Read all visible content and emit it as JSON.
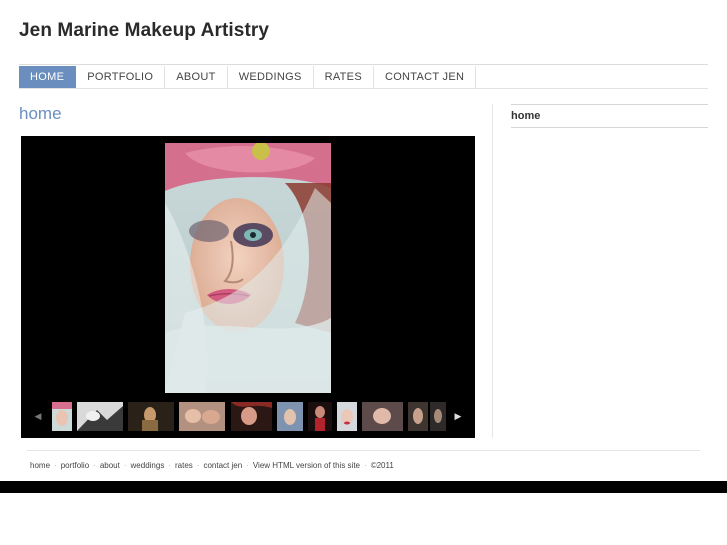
{
  "site": {
    "title": "Jen Marine Makeup Artistry"
  },
  "nav": {
    "items": [
      {
        "label": "HOME",
        "active": true
      },
      {
        "label": "PORTFOLIO"
      },
      {
        "label": "ABOUT"
      },
      {
        "label": "WEDDINGS"
      },
      {
        "label": "RATES"
      },
      {
        "label": "CONTACT JEN"
      }
    ]
  },
  "main": {
    "page_title": "home"
  },
  "slideshow": {
    "prev_icon": "chevron-left-icon",
    "next_icon": "chevron-right-icon",
    "thumb_count": 11
  },
  "sidebar": {
    "links": [
      {
        "label": "home"
      }
    ]
  },
  "footer": {
    "links": [
      "home",
      "portfolio",
      "about",
      "weddings",
      "rates",
      "contact jen",
      "View HTML version of this site"
    ],
    "copyright": "©2011"
  }
}
